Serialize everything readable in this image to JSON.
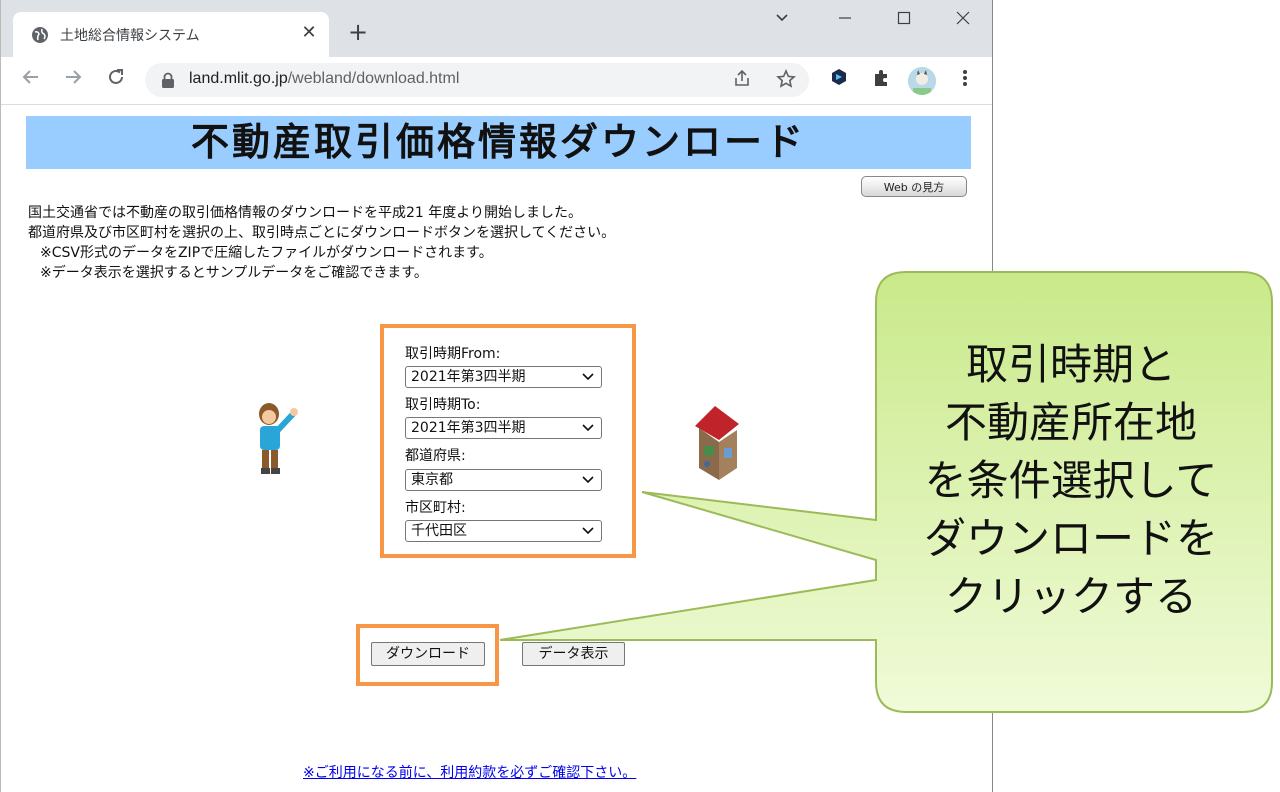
{
  "browser": {
    "tab_title": "土地総合情報システム",
    "tab_close": "✕",
    "new_tab": "+",
    "url_host": "land.mlit.go.jp",
    "url_path": "/webland/download.html",
    "window_controls": {
      "menu": "⌄",
      "minimize": "—",
      "maximize": "☐",
      "close": "✕"
    },
    "icons": [
      "globe-icon",
      "back-icon",
      "forward-icon",
      "reload-icon",
      "lock-icon",
      "share-icon",
      "star-icon",
      "extension-hex-icon",
      "puzzle-icon",
      "avatar",
      "more-icon"
    ]
  },
  "page": {
    "banner_title": "不動産取引価格情報ダウンロード",
    "help_button": "Web の見方",
    "intro": {
      "line1": "国土交通省では不動産の取引価格情報のダウンロードを平成21 年度より開始しました。",
      "line2": "都道府県及び市区町村を選択の上、取引時点ごとにダウンロードボタンを選択してください。",
      "line3": "※CSV形式のデータをZIPで圧縮したファイルがダウンロードされます。",
      "line4": "※データ表示を選択するとサンプルデータをご確認できます。"
    },
    "form": {
      "from_label": "取引時期From:",
      "from_value": "2021年第3四半期",
      "to_label": "取引時期To:",
      "to_value": "2021年第3四半期",
      "pref_label": "都道府県:",
      "pref_value": "東京都",
      "city_label": "市区町村:",
      "city_value": "千代田区"
    },
    "download_button": "ダウンロード",
    "display_button": "データ表示",
    "terms_link": "※ご利用になる前に、利用約款を必ずご確認下さい。"
  },
  "callout": {
    "line1": "取引時期と",
    "line2": "不動産所在地",
    "line3": "を条件選択して",
    "line4": "ダウンロードを",
    "line5": "クリックする"
  },
  "colors": {
    "banner": "#99ccff",
    "highlight_border": "#f79646",
    "callout_fill": "#d7f0a0",
    "callout_border": "#9bbb59"
  }
}
